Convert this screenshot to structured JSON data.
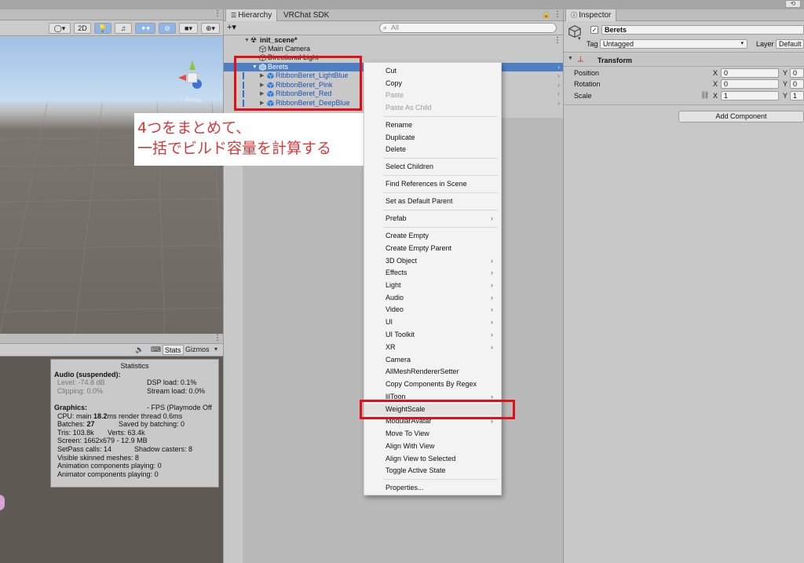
{
  "topbar": {
    "collab_icon": "history-icon"
  },
  "scene": {
    "toolbar": {
      "mode_2d": "2D",
      "gizmo_label": "< Persp"
    }
  },
  "game": {
    "toolbar": {
      "stats_label": "Stats",
      "gizmos_label": "Gizmos"
    },
    "statistics": {
      "title": "Statistics",
      "audio_heading": "Audio (suspended):",
      "level": "Level: -74.8 dB",
      "dsp_load": "DSP load: 0.1%",
      "clipping": "Clipping: 0.0%",
      "stream_load": "Stream load: 0.0%",
      "graphics_heading": "Graphics:",
      "fps": "- FPS (Playmode Off",
      "cpu_prefix": "CPU: main ",
      "cpu_main": "18.2",
      "cpu_suffix": "ms  render thread 0.6ms",
      "batches_prefix": "Batches: ",
      "batches": "27",
      "saved_batching": "Saved by batching: 0",
      "tris": "Tris: 103.8k",
      "verts": "Verts: 63.4k",
      "screen": "Screen: 1662x679 - 12.9 MB",
      "setpass": "SetPass calls: 14",
      "shadow_casters": "Shadow casters: 8",
      "skinned": "Visible skinned meshes: 8",
      "anim_playing": "Animation components playing: 0",
      "animator_playing": "Animator components playing: 0"
    }
  },
  "hierarchy": {
    "tabs": [
      "Hierarchy",
      "VRChat SDK"
    ],
    "add_label": "+▾",
    "search_placeholder": "All",
    "items": [
      {
        "label": "init_scene*"
      },
      {
        "label": "Main Camera"
      },
      {
        "label": "Directional Light"
      },
      {
        "label": "Berets"
      },
      {
        "label": "RibbonBeret_LightBlue"
      },
      {
        "label": "RibbonBeret_Pink"
      },
      {
        "label": "RibbonBeret_Red"
      },
      {
        "label": "RibbonBeret_DeepBlue"
      }
    ]
  },
  "annotation": {
    "line1": "4つをまとめて、",
    "line2": "一括でビルド容量を計算する"
  },
  "context_menu": {
    "items": [
      {
        "label": "Cut"
      },
      {
        "label": "Copy"
      },
      {
        "label": "Paste"
      },
      {
        "label": "Paste As Child"
      },
      {
        "label": "Rename"
      },
      {
        "label": "Duplicate"
      },
      {
        "label": "Delete"
      },
      {
        "label": "Select Children"
      },
      {
        "label": "Find References in Scene"
      },
      {
        "label": "Set as Default Parent"
      },
      {
        "label": "Prefab"
      },
      {
        "label": "Create Empty"
      },
      {
        "label": "Create Empty Parent"
      },
      {
        "label": "3D Object"
      },
      {
        "label": "Effects"
      },
      {
        "label": "Light"
      },
      {
        "label": "Audio"
      },
      {
        "label": "Video"
      },
      {
        "label": "UI"
      },
      {
        "label": "UI Toolkit"
      },
      {
        "label": "XR"
      },
      {
        "label": "Camera"
      },
      {
        "label": "AllMeshRendererSetter"
      },
      {
        "label": "Copy Components By Regex"
      },
      {
        "label": "lilToon"
      },
      {
        "label": "WeightScale"
      },
      {
        "label": "ModularAvatar"
      },
      {
        "label": "Move To View"
      },
      {
        "label": "Align With View"
      },
      {
        "label": "Align View to Selected"
      },
      {
        "label": "Toggle Active State"
      },
      {
        "label": "Properties..."
      }
    ]
  },
  "inspector": {
    "tab": "Inspector",
    "object_name": "Berets",
    "tag_label": "Tag",
    "tag_value": "Untagged",
    "layer_label": "Layer",
    "layer_value": "Default",
    "transform_title": "Transform",
    "position_label": "Position",
    "rotation_label": "Rotation",
    "scale_label": "Scale",
    "axis_x": "X",
    "axis_y": "Y",
    "position_x": "0",
    "position_y": "0",
    "rotation_x": "0",
    "rotation_y": "0",
    "scale_x": "1",
    "scale_y": "1",
    "add_component": "Add Component"
  },
  "colors": {
    "selection": "#4f7fc3",
    "highlight_red": "#e20f15",
    "annotation_text": "#d33a3a",
    "child_text": "#1b54b6"
  }
}
